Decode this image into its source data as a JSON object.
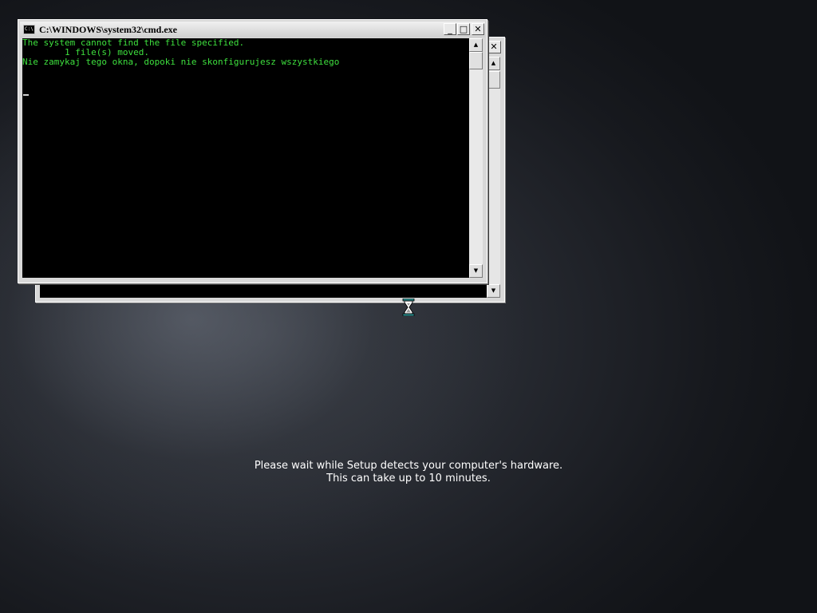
{
  "cmd_window": {
    "title": "C:\\WINDOWS\\system32\\cmd.exe",
    "icon": "console-icon",
    "icon_text": "C:\\",
    "buttons": {
      "minimize": "_",
      "maximize": "□",
      "close": "✕"
    },
    "console_lines": [
      "The system cannot find the file specified.",
      "        1 file(s) moved.",
      "Nie zamykaj tego okna, dopoki nie skonfigurujesz wszystkiego"
    ],
    "scroll_up": "▲",
    "scroll_down": "▼"
  },
  "back_window": {
    "close": "✕",
    "scroll_up": "▲",
    "scroll_down": "▼"
  },
  "cursor": {
    "icon": "hourglass-icon"
  },
  "setup_status": {
    "line1": "Please wait while Setup detects your computer's hardware.",
    "line2": "This can take up to 10 minutes."
  },
  "colors": {
    "console_text": "#3ee03e",
    "console_bg": "#000000",
    "desktop_bg": "#1e2127"
  }
}
